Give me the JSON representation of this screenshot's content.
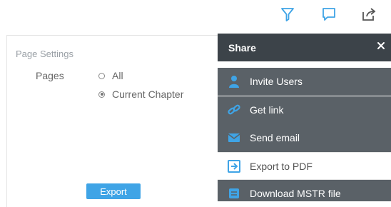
{
  "toolbar": {
    "icons": [
      "filter-icon",
      "comment-icon",
      "share-icon"
    ],
    "accent": "#3fa4e6"
  },
  "settings": {
    "title": "Page Settings",
    "pages_label": "Pages",
    "options": [
      {
        "label": "All",
        "selected": false
      },
      {
        "label": "Current Chapter",
        "selected": true
      }
    ],
    "export_label": "Export"
  },
  "share": {
    "title": "Share",
    "close_icon": "close-icon",
    "items": [
      {
        "label": "Invite Users",
        "icon": "user-icon"
      },
      {
        "label": "Get link",
        "icon": "link-icon"
      },
      {
        "label": "Send email",
        "icon": "email-icon"
      },
      {
        "label": "Export to PDF",
        "icon": "export-icon"
      },
      {
        "label": "Download MSTR file",
        "icon": "download-icon"
      }
    ],
    "colors": {
      "header": "#3c4349",
      "item": "#5a6167",
      "icon": "#3fa4e6"
    }
  }
}
